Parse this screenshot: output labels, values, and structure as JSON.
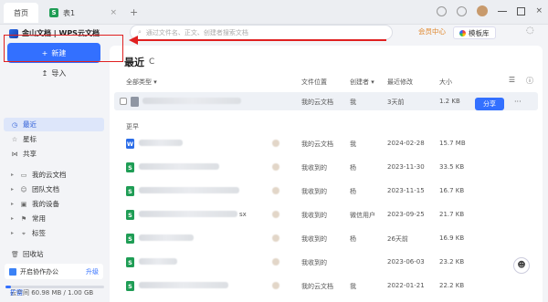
{
  "titlebar": {
    "tabs": [
      {
        "label": "首页"
      },
      {
        "label": "表1",
        "icon": "sheet-icon",
        "icon_letter": "S"
      }
    ],
    "new_tab": "+",
    "close": "×"
  },
  "brand": {
    "name": "金山文档 | WPS云文档"
  },
  "sidebar": {
    "new_label": "新建",
    "new_icon": "+",
    "import_label": "导入",
    "import_icon": "↥",
    "items": [
      {
        "label": "最近",
        "icon": "clock-icon",
        "glyph": "◷",
        "active": true,
        "expandable": false
      },
      {
        "label": "星标",
        "icon": "star-icon",
        "glyph": "☆",
        "active": false,
        "expandable": false
      },
      {
        "label": "共享",
        "icon": "share-icon",
        "glyph": "⋈",
        "active": false,
        "expandable": false
      },
      {
        "label": "我的云文档",
        "icon": "cloud-folder-icon",
        "glyph": "▭",
        "active": false,
        "expandable": true
      },
      {
        "label": "团队文档",
        "icon": "team-icon",
        "glyph": "☺",
        "active": false,
        "expandable": true
      },
      {
        "label": "我的设备",
        "icon": "device-icon",
        "glyph": "▣",
        "active": false,
        "expandable": true
      },
      {
        "label": "常用",
        "icon": "bookmark-icon",
        "glyph": "⚑",
        "active": false,
        "expandable": true
      },
      {
        "label": "标签",
        "icon": "tag-icon",
        "glyph": "⌖",
        "active": false,
        "expandable": true
      },
      {
        "label": "回收站",
        "icon": "trash-icon",
        "glyph": "🗑",
        "active": false,
        "expandable": false
      }
    ],
    "collab": {
      "label": "开启协作办公",
      "upgrade": "升级"
    },
    "storage": {
      "text": "云空间 60.98 MB / 1.00 GB",
      "expand": "扩容",
      "used_fraction": 0.06
    }
  },
  "search": {
    "placeholder": "通过文件名、正文、创建者搜索文档"
  },
  "top": {
    "vip": "会员中心",
    "templates": "模板库"
  },
  "main": {
    "title": "最近",
    "refresh": "C",
    "columns": {
      "type": "全部类型 ▾",
      "location": "文件位置",
      "creator": "创建者 ▾",
      "modified": "最近修改",
      "size": "大小"
    },
    "pinned": {
      "location": "我的云文档",
      "creator": "我",
      "modified": "3天前",
      "size": "1.2 KB",
      "share": "分享",
      "more": "···"
    },
    "section_label": "更早",
    "rows": [
      {
        "kind": "w",
        "letter": "W",
        "location": "我的云文档",
        "creator": "我",
        "modified": "2024-02-28",
        "size": "15.7 MB",
        "suffix": ""
      },
      {
        "kind": "s",
        "letter": "S",
        "location": "我收到的",
        "creator": "杨",
        "modified": "2023-11-30",
        "size": "33.5 KB",
        "suffix": ""
      },
      {
        "kind": "s",
        "letter": "S",
        "location": "我收到的",
        "creator": "杨",
        "modified": "2023-11-15",
        "size": "16.7 KB",
        "suffix": ""
      },
      {
        "kind": "s",
        "letter": "S",
        "location": "我收到的",
        "creator": "微信用户",
        "modified": "2023-09-25",
        "size": "21.7 KB",
        "suffix": "sx"
      },
      {
        "kind": "s",
        "letter": "S",
        "location": "我收到的",
        "creator": "杨",
        "modified": "26天前",
        "size": "16.9 KB",
        "suffix": ""
      },
      {
        "kind": "s",
        "letter": "S",
        "location": "我收到的",
        "creator": "",
        "modified": "2023-06-03",
        "size": "23.2 KB",
        "suffix": ""
      },
      {
        "kind": "s",
        "letter": "S",
        "location": "我的云文档",
        "creator": "我",
        "modified": "2022-01-21",
        "size": "22.2 KB",
        "suffix": ""
      }
    ]
  },
  "colors": {
    "accent": "#3370ff",
    "annotation": "#e02020",
    "sheet": "#1f9d55",
    "doc": "#2b6de8"
  }
}
